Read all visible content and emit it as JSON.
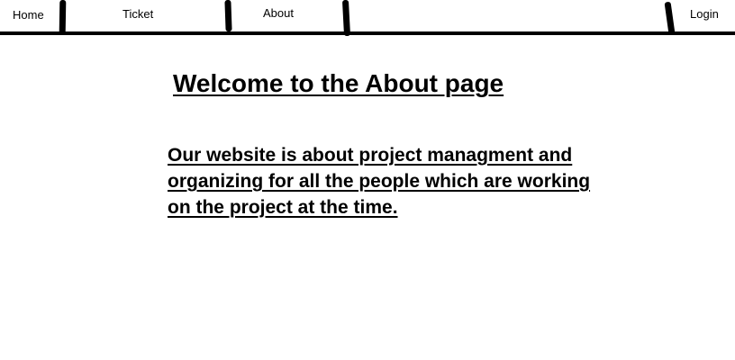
{
  "nav": {
    "items": [
      {
        "label": "Home"
      },
      {
        "label": "Ticket"
      },
      {
        "label": "About"
      }
    ],
    "login_label": "Login"
  },
  "main": {
    "title": "Welcome to the About page",
    "description": "Our website is about project managment and organizing for all the people which are working on the project at the time."
  },
  "colors": {
    "background": "#ffffff",
    "text": "#000000",
    "lines": "#000000"
  }
}
